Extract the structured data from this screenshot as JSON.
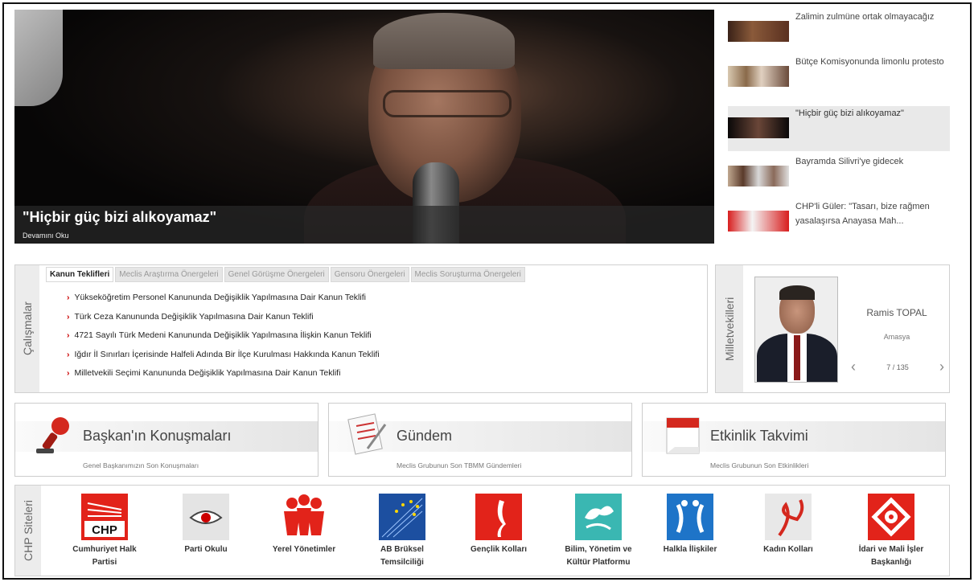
{
  "hero": {
    "caption": "\"Hiçbir güç bizi alıkoyamaz\"",
    "read_more": "Devamını Oku"
  },
  "news": [
    {
      "text": "Zalimin zulmüne ortak olmayacağız",
      "active": false
    },
    {
      "text": "Bütçe Komisyonunda limonlu protesto",
      "active": false
    },
    {
      "text": "\"Hiçbir güç bizi alıkoyamaz\"",
      "active": true
    },
    {
      "text": "Bayramda Silivri'ye gidecek",
      "active": false
    },
    {
      "text": "CHP'li Güler: \"Tasarı, bize rağmen yasalaşırsa Anayasa Mah...",
      "active": false
    }
  ],
  "works": {
    "section_label": "Çalışmalar",
    "tabs": [
      "Kanun Teklifleri",
      "Meclis Araştırma Önergeleri",
      "Genel Görüşme Önergeleri",
      "Gensoru Önergeleri",
      "Meclis Soruşturma Önergeleri"
    ],
    "items": [
      "Yükseköğretim Personel Kanununda Değişiklik Yapılmasına Dair Kanun Teklifi",
      "Türk Ceza Kanununda Değişiklik Yapılmasına Dair Kanun Teklifi",
      "4721 Sayılı Türk Medeni Kanununda Değişiklik Yapılmasına İlişkin Kanun Teklifi",
      "Iğdır İl Sınırları İçerisinde Halfeli Adında Bir İlçe Kurulması Hakkında Kanun Teklifi",
      "Milletvekili Seçimi Kanununda Değişiklik Yapılmasına Dair Kanun Teklifi"
    ]
  },
  "mp": {
    "section_label": "Milletvekilleri",
    "name": "Ramis TOPAL",
    "city": "Amasya",
    "counter": "7 / 135"
  },
  "features": [
    {
      "title": "Başkan'ın Konuşmaları",
      "sub": "Genel Başkanımızın Son Konuşmaları"
    },
    {
      "title": "Gündem",
      "sub": "Meclis Grubunun Son TBMM Gündemleri"
    },
    {
      "title": "Etkinlik Takvimi",
      "sub": "Meclis Grubunun Son Etkinlikleri"
    }
  ],
  "sites": {
    "section_label": "CHP Siteleri",
    "logo_text": "CHP",
    "items": [
      {
        "label": "Cumhuriyet Halk Partisi"
      },
      {
        "label": "Parti Okulu"
      },
      {
        "label": "Yerel Yönetimler"
      },
      {
        "label": "AB Brüksel Temsilciliği"
      },
      {
        "label": "Gençlik Kolları"
      },
      {
        "label": "Bilim, Yönetim ve Kültür Platformu"
      },
      {
        "label": "Halkla İlişkiler"
      },
      {
        "label": "Kadın Kolları"
      },
      {
        "label": "İdari ve Mali İşler Başkanlığı"
      }
    ]
  }
}
